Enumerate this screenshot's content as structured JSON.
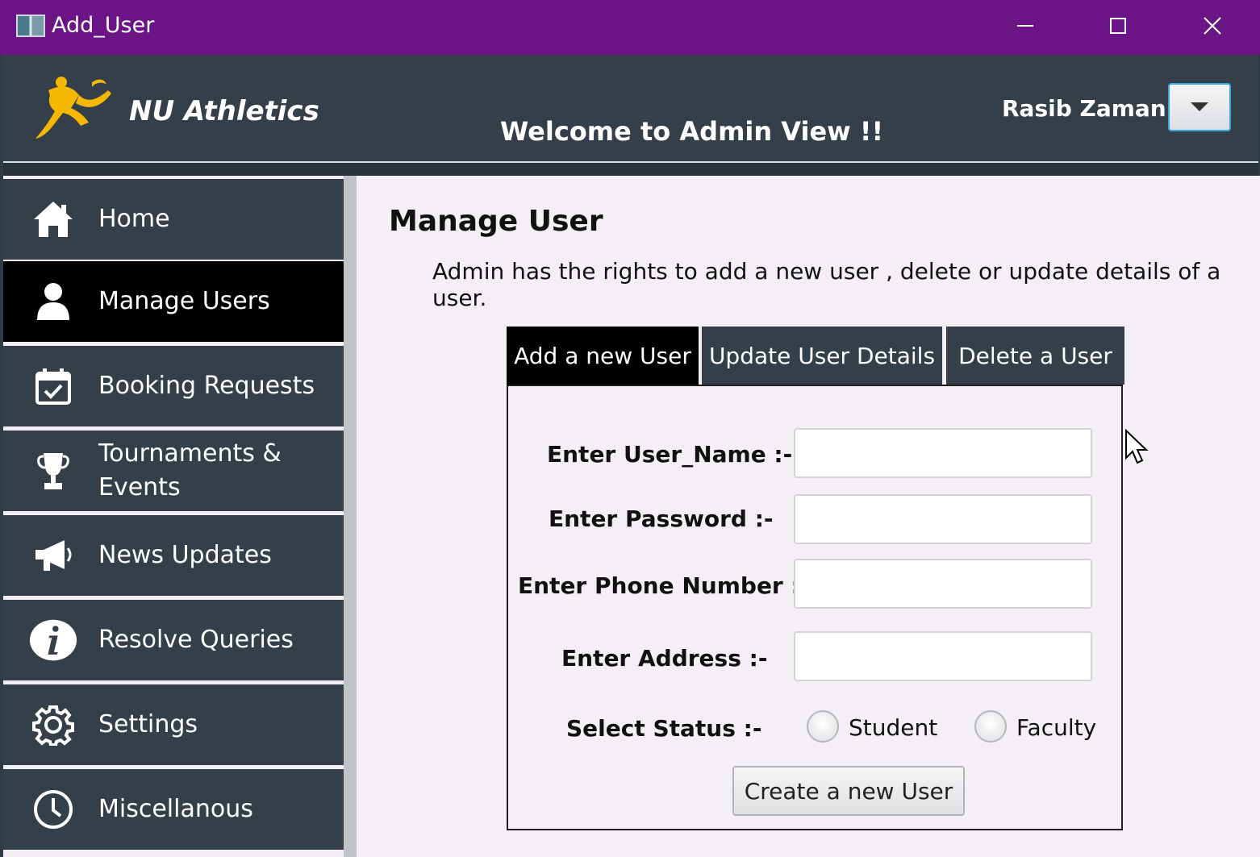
{
  "window": {
    "title": "Add_User"
  },
  "header": {
    "brand": "NU Athletics",
    "welcome": "Welcome to Admin View !!",
    "username": "Rasib Zaman"
  },
  "sidebar": {
    "items": [
      {
        "label": "Home",
        "icon": "home-icon"
      },
      {
        "label": "Manage Users",
        "icon": "user-icon",
        "active": true
      },
      {
        "label": "Booking Requests",
        "icon": "calendar-check-icon"
      },
      {
        "label": "Tournaments &",
        "label2": "Events",
        "icon": "trophy-icon"
      },
      {
        "label": "News Updates",
        "icon": "megaphone-icon"
      },
      {
        "label": "Resolve Queries",
        "icon": "info-icon"
      },
      {
        "label": "Settings",
        "icon": "gear-icon"
      },
      {
        "label": "Miscellanous",
        "icon": "clock-icon"
      }
    ]
  },
  "main": {
    "heading": "Manage User",
    "description": "Admin has the rights to add a new user , delete or update details of a user.",
    "tabs": [
      {
        "label": "Add a new User",
        "active": true
      },
      {
        "label": "Update User Details"
      },
      {
        "label": "Delete a User"
      }
    ],
    "form": {
      "username_label": "Enter User_Name :-",
      "password_label": "Enter Password :-",
      "phone_label": "Enter Phone Number :-",
      "address_label": "Enter Address :-",
      "status_label": "Select Status :-",
      "status_options": [
        "Student",
        "Faculty"
      ],
      "username_value": "",
      "password_value": "",
      "phone_value": "",
      "address_value": "",
      "submit_label": "Create a new User"
    }
  },
  "colors": {
    "titlebar": "#6b1485",
    "panel_dark": "#343f49",
    "active": "#000000",
    "logo": "#f5b800",
    "content_bg": "#f3eff5"
  }
}
